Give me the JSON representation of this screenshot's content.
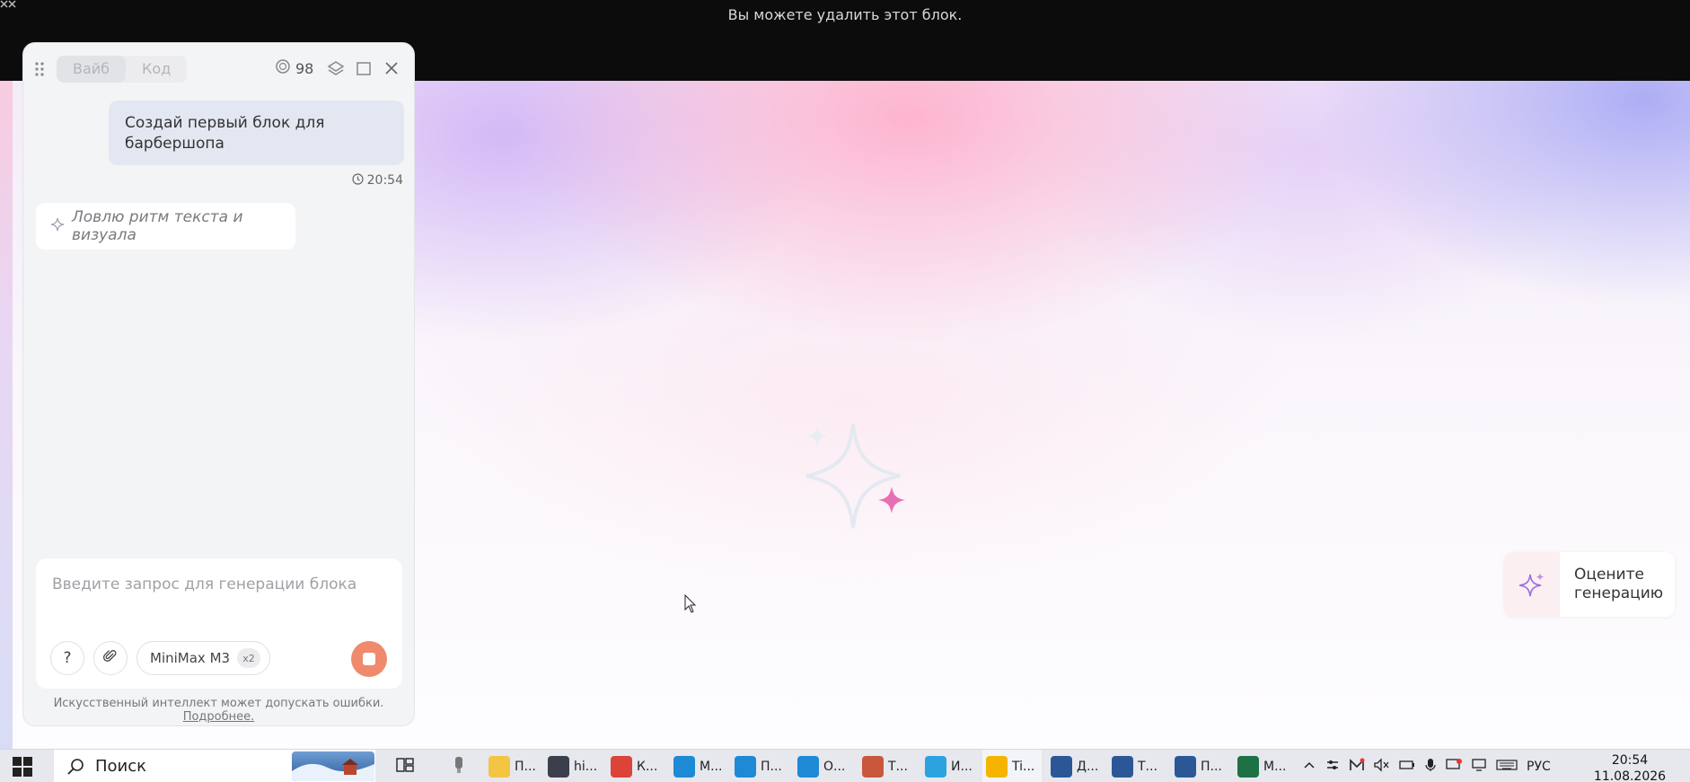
{
  "banner": {
    "message": "Вы можете удалить этот блок."
  },
  "chat": {
    "tabs": [
      {
        "label": "Вайб",
        "active": true
      },
      {
        "label": "Код",
        "active": false
      }
    ],
    "credits": "98",
    "user_message": "Создай первый блок для барбершопа",
    "message_time": "20:54",
    "assistant_status": "Ловлю ритм текста и визуала",
    "input": {
      "placeholder": "Введите запрос для генерации блока",
      "value": ""
    },
    "help_label": "?",
    "model": {
      "name": "MiniMax M3",
      "multiplier": "x2"
    },
    "disclaimer": "Искусственный интеллект может допускать ошибки.",
    "disclaimer_link": "Подробнее."
  },
  "rate": {
    "label": "Оцените генерацию"
  },
  "colors": {
    "accent_stop": "#f08a6d",
    "bubble": "#e3e7f2",
    "panel": "#f3f4f6"
  },
  "taskbar": {
    "search_label": "Поиск",
    "items": [
      {
        "label": "П...",
        "icon": "folder-icon",
        "color": "#f4c542"
      },
      {
        "label": "hi...",
        "icon": "app-icon",
        "color": "#3a3f4b"
      },
      {
        "label": "К...",
        "icon": "chrome-icon",
        "color": "#db4437"
      },
      {
        "label": "М...",
        "icon": "vscode-icon",
        "color": "#1e8ad6"
      },
      {
        "label": "П...",
        "icon": "vscode-icon",
        "color": "#1e8ad6"
      },
      {
        "label": "О...",
        "icon": "vscode-icon",
        "color": "#1e8ad6"
      },
      {
        "label": "Т...",
        "icon": "yandex-icon",
        "color": "#c9573c"
      },
      {
        "label": "И...",
        "icon": "telegram-icon",
        "color": "#2aa3df"
      },
      {
        "label": "Ti...",
        "icon": "yandex-browser-icon",
        "color": "#f5b400"
      },
      {
        "label": "Д...",
        "icon": "word-icon",
        "color": "#2b5797"
      },
      {
        "label": "Т...",
        "icon": "word-icon",
        "color": "#2b5797"
      },
      {
        "label": "П...",
        "icon": "word-icon",
        "color": "#2b5797"
      },
      {
        "label": "М...",
        "icon": "excel-icon",
        "color": "#1e7145"
      }
    ],
    "language": "РУС",
    "time": "20:54",
    "date": "11.08.2026"
  }
}
